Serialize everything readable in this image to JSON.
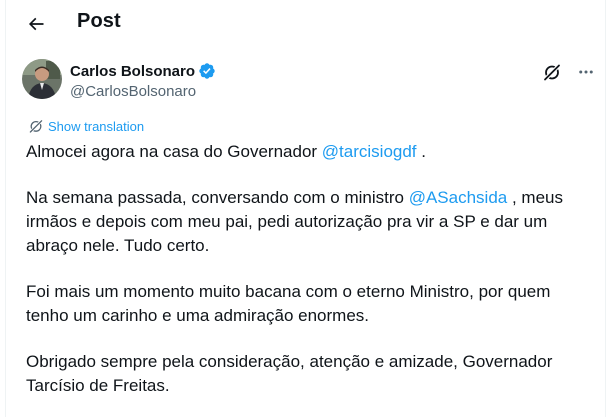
{
  "header": {
    "title": "Post"
  },
  "author": {
    "display_name": "Carlos Bolsonaro",
    "handle": "@CarlosBolsonaro"
  },
  "translate_label": "Show translation",
  "tweet": {
    "p1_before": "Almocei agora na casa do Governador ",
    "p1_mention": "@tarcisiogdf",
    "p1_after": " .",
    "p2_before": "Na semana passada, conversando com o ministro ",
    "p2_mention": "@ASachsida",
    "p2_after": " , meus irmãos e depois com meu pai, pedi autorização pra vir a SP e dar um abraço nele. Tudo certo.",
    "p3": "Foi mais um momento muito bacana com o eterno Ministro, por quem tenho um carinho e uma admiração enormes.",
    "p4": "Obrigado sempre pela consideração, atenção e amizade, Governador Tarcísio de Freitas."
  },
  "icons": {
    "back": "arrow-left-icon",
    "verified": "verified-badge-icon",
    "grok": "grok-icon",
    "more": "more-icon",
    "translate": "translate-icon"
  },
  "colors": {
    "accent": "#1d9bf0",
    "text": "#0f1419",
    "muted": "#536471"
  }
}
